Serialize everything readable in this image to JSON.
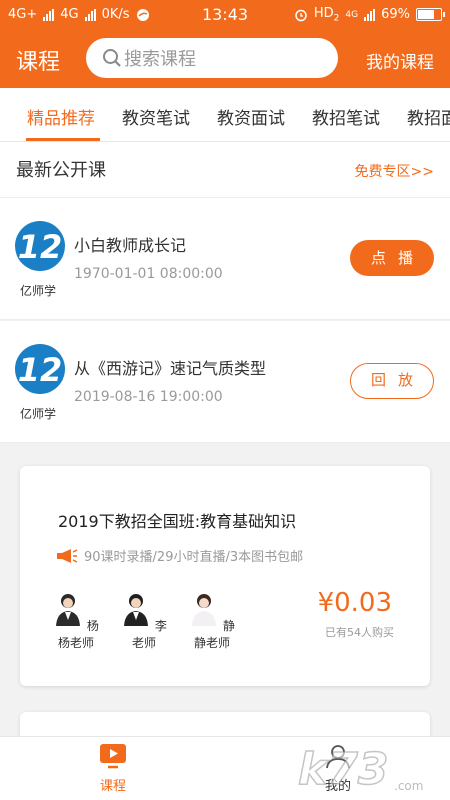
{
  "status_bar": {
    "network1": "4G+",
    "network2": "4G",
    "speed": "0K/s",
    "time": "13:43",
    "hd": "HD",
    "hd_sub": "2",
    "net_small": "4G",
    "battery": "69%"
  },
  "header": {
    "title": "课程",
    "search_placeholder": "搜索课程",
    "my_courses": "我的课程"
  },
  "tabs": [
    {
      "label": "精品推荐",
      "active": true
    },
    {
      "label": "教资笔试",
      "active": false
    },
    {
      "label": "教资面试",
      "active": false
    },
    {
      "label": "教招笔试",
      "active": false
    },
    {
      "label": "教招面",
      "active": false
    }
  ],
  "section": {
    "title": "最新公开课",
    "more": "免费专区>>"
  },
  "lessons": [
    {
      "logo_caption": "亿师学",
      "name": "小白教师成长记",
      "date": "1970-01-01 08:00:00",
      "action": "点播"
    },
    {
      "logo_caption": "亿师学",
      "name": "从《西游记》速记气质类型",
      "date": "2019-08-16 19:00:00",
      "action": "回放"
    }
  ],
  "course_card": {
    "title": "2019下教招全国班:教育基础知识",
    "features": "90课时录播/29小时直播/3本图书包邮",
    "teachers": [
      "杨杨老师",
      "李老师",
      "静静老师"
    ],
    "price": "¥0.03",
    "sold": "已有54人购买"
  },
  "bottom_nav": {
    "course": "课程",
    "me": "我的"
  },
  "watermark": "k73",
  "watermark_suffix": ".com",
  "colors": {
    "brand": "#f26b1d",
    "logo_blue": "#1a7fc4"
  }
}
